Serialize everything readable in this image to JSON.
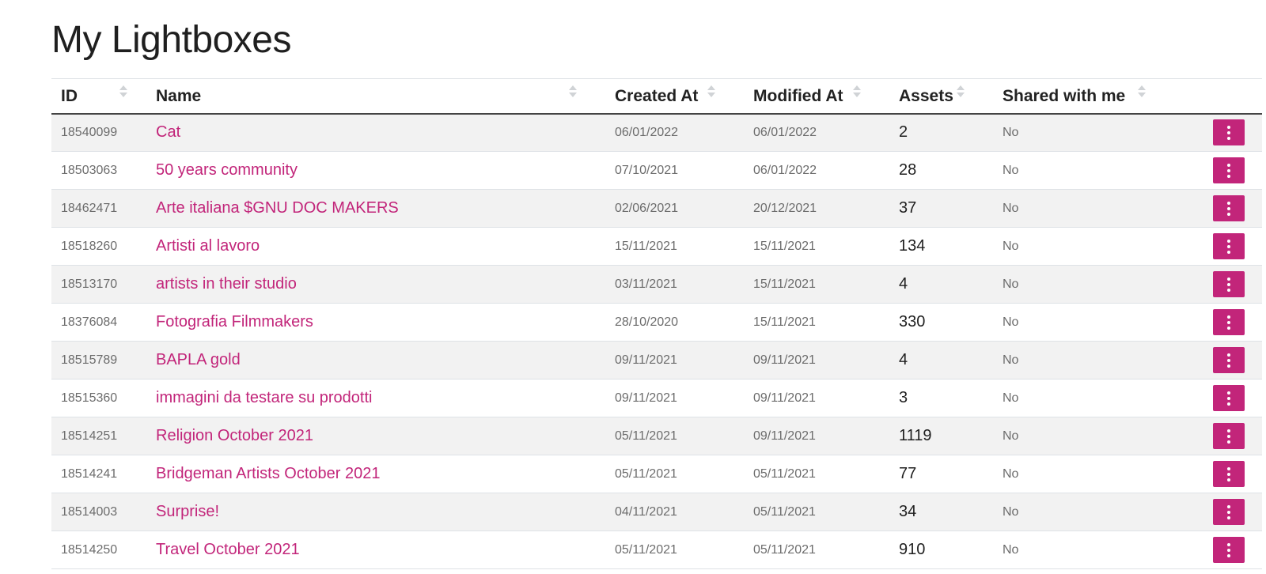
{
  "page": {
    "title": "My Lightboxes"
  },
  "table": {
    "columns": {
      "id": "ID",
      "name": "Name",
      "created": "Created At",
      "modified": "Modified At",
      "assets": "Assets",
      "shared": "Shared with me"
    },
    "rows": [
      {
        "id": "18540099",
        "name": "Cat",
        "created": "06/01/2022",
        "modified": "06/01/2022",
        "assets": "2",
        "shared": "No"
      },
      {
        "id": "18503063",
        "name": "50 years community",
        "created": "07/10/2021",
        "modified": "06/01/2022",
        "assets": "28",
        "shared": "No"
      },
      {
        "id": "18462471",
        "name": "Arte italiana $GNU DOC MAKERS",
        "created": "02/06/2021",
        "modified": "20/12/2021",
        "assets": "37",
        "shared": "No"
      },
      {
        "id": "18518260",
        "name": "Artisti al lavoro",
        "created": "15/11/2021",
        "modified": "15/11/2021",
        "assets": "134",
        "shared": "No"
      },
      {
        "id": "18513170",
        "name": "artists in their studio",
        "created": "03/11/2021",
        "modified": "15/11/2021",
        "assets": "4",
        "shared": "No"
      },
      {
        "id": "18376084",
        "name": "Fotografia Filmmakers",
        "created": "28/10/2020",
        "modified": "15/11/2021",
        "assets": "330",
        "shared": "No"
      },
      {
        "id": "18515789",
        "name": "BAPLA gold",
        "created": "09/11/2021",
        "modified": "09/11/2021",
        "assets": "4",
        "shared": "No"
      },
      {
        "id": "18515360",
        "name": "immagini da testare su prodotti",
        "created": "09/11/2021",
        "modified": "09/11/2021",
        "assets": "3",
        "shared": "No"
      },
      {
        "id": "18514251",
        "name": "Religion October 2021",
        "created": "05/11/2021",
        "modified": "09/11/2021",
        "assets": "1119",
        "shared": "No"
      },
      {
        "id": "18514241",
        "name": "Bridgeman Artists October 2021",
        "created": "05/11/2021",
        "modified": "05/11/2021",
        "assets": "77",
        "shared": "No"
      },
      {
        "id": "18514003",
        "name": "Surprise!",
        "created": "04/11/2021",
        "modified": "05/11/2021",
        "assets": "34",
        "shared": "No"
      },
      {
        "id": "18514250",
        "name": "Travel October 2021",
        "created": "05/11/2021",
        "modified": "05/11/2021",
        "assets": "910",
        "shared": "No"
      }
    ]
  },
  "icons": {
    "sort": "sort-arrows-icon",
    "row_menu": "vertical-ellipsis-icon"
  },
  "colors": {
    "accent": "#c2257a",
    "stripe": "#f2f2f2"
  }
}
